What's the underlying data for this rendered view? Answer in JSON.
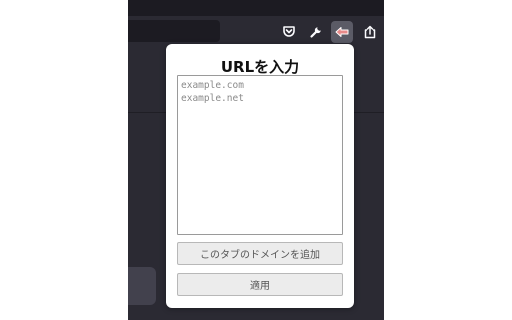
{
  "toolbar": {
    "icons": [
      "pocket-icon",
      "wrench-icon",
      "extension-active-icon",
      "share-icon"
    ]
  },
  "popup": {
    "title": "URLを入力",
    "textarea": {
      "value": "",
      "placeholder": "example.com\nexample.net"
    },
    "add_domain_button": "このタブのドメインを追加",
    "apply_button": "適用"
  },
  "colors": {
    "browser_chrome": "#2b2a33",
    "topstrip": "#1c1b22",
    "active_icon_bg": "#5b5b66",
    "active_icon_accent": "#e88a8a",
    "button_bg": "#ececec"
  }
}
